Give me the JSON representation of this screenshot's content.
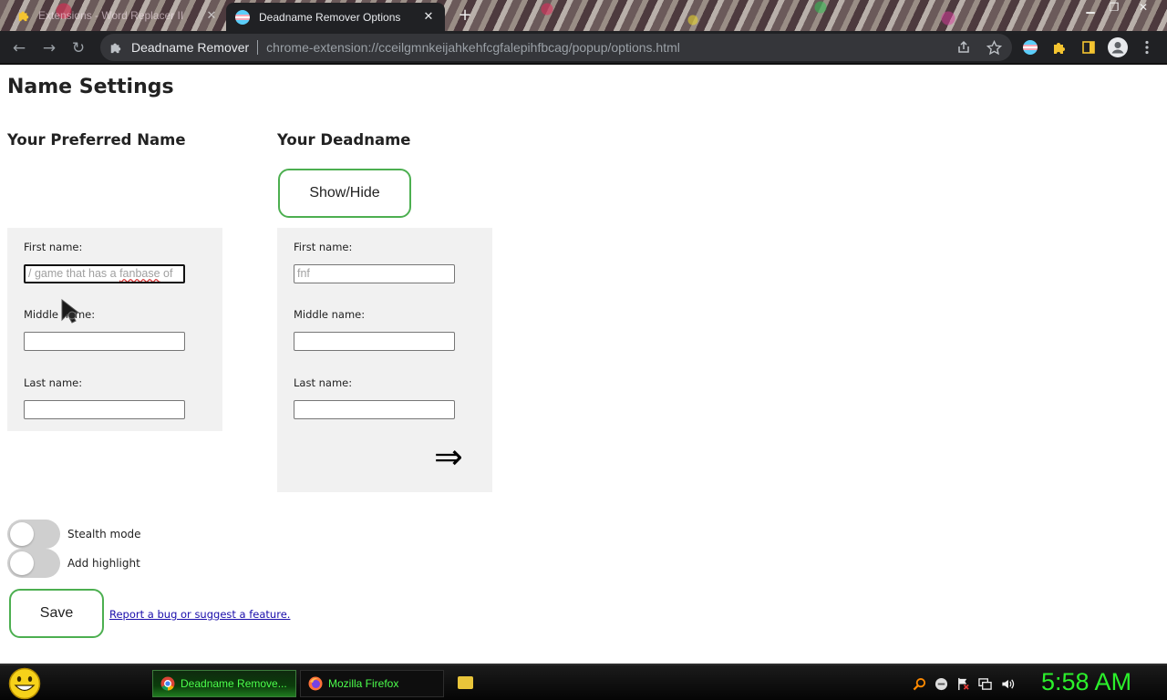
{
  "browser": {
    "tabs": [
      {
        "title": "Extensions - Word Replacer II",
        "active": false
      },
      {
        "title": "Deadname Remover Options",
        "active": true
      }
    ],
    "omnibox": {
      "origin": "Deadname Remover",
      "url": "chrome-extension://cceilgmnkeijahkehfcgfalepihfbcag/popup/options.html"
    }
  },
  "page": {
    "title": "Name Settings",
    "preferred": {
      "heading": "Your Preferred Name",
      "first_label": "First name:",
      "first_value_pre": "/ game that has a ",
      "first_value_spell": "fanbase",
      "first_value_post": " of",
      "middle_label": "Middle name:",
      "middle_value": "",
      "last_label": "Last name:",
      "last_value": ""
    },
    "deadname": {
      "heading": "Your Deadname",
      "showhide_label": "Show/Hide",
      "first_label": "First name:",
      "first_value": "fnf",
      "middle_label": "Middle name:",
      "middle_value": "",
      "last_label": "Last name:",
      "last_value": "",
      "arrow": "⇒"
    },
    "toggles": [
      {
        "label": "Stealth mode",
        "on": false
      },
      {
        "label": "Add highlight",
        "on": false
      }
    ],
    "save_label": "Save",
    "report_link": "Report a bug or suggest a feature."
  },
  "taskbar": {
    "buttons": [
      {
        "label": "Deadname Remove...",
        "active": true
      },
      {
        "label": "Mozilla Firefox",
        "active": false
      }
    ],
    "clock": "5:58 AM"
  },
  "colors": {
    "button_border": "#4caf50",
    "clock": "#2bf02b",
    "taskbar_text": "#4cff4c",
    "panel_bg": "#f1f1f1"
  }
}
